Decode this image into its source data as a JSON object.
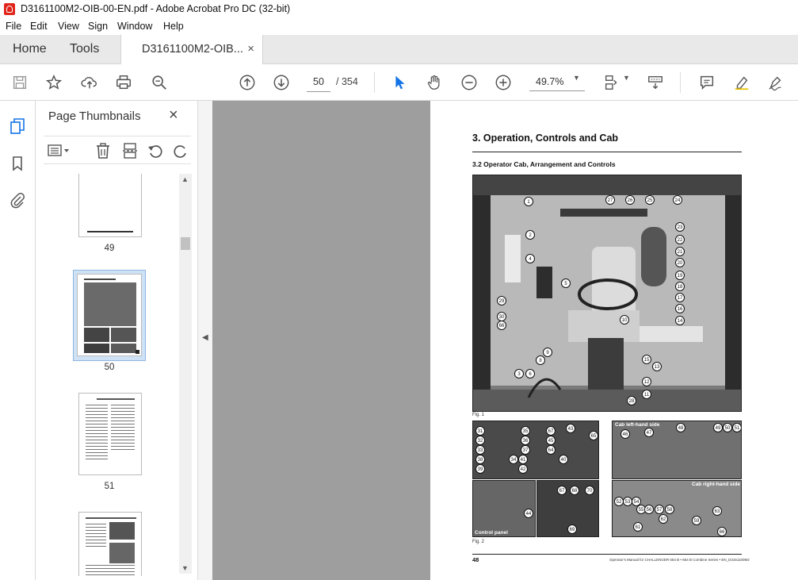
{
  "window": {
    "title": "D3161100M2-OIB-00-EN.pdf - Adobe Acrobat Pro DC (32-bit)"
  },
  "menu": [
    "File",
    "Edit",
    "View",
    "Sign",
    "Window",
    "Help"
  ],
  "tabs": {
    "home": "Home",
    "tools": "Tools",
    "document": "D3161100M2-OIB...",
    "close": "×"
  },
  "toolbar": {
    "page_current": "50",
    "page_total": "/ 354",
    "zoom": "49.7%"
  },
  "thumbnails": {
    "title": "Page Thumbnails",
    "close": "×",
    "pages": [
      {
        "label": "49",
        "selected": false
      },
      {
        "label": "50",
        "selected": true
      },
      {
        "label": "51",
        "selected": false
      },
      {
        "label": "",
        "selected": false
      }
    ]
  },
  "document": {
    "heading": "3. Operation, Controls and Cab",
    "subheading": "3.2     Operator Cab, Arrangement and Controls",
    "fig1_label": "Fig. 1",
    "fig2_label": "Fig. 2",
    "panel_labels": {
      "left_side": "Cab left-hand side",
      "right_side": "Cab right-hand side",
      "control_panel": "Control panel"
    },
    "callouts_main": [
      "1",
      "2",
      "3",
      "4",
      "5",
      "6",
      "7",
      "8",
      "9",
      "10",
      "11",
      "12",
      "13",
      "14",
      "15",
      "16",
      "17",
      "18",
      "19",
      "20",
      "21",
      "22",
      "23",
      "24",
      "25",
      "26",
      "27",
      "28",
      "29",
      "30",
      "66"
    ],
    "callouts_controls": [
      "31",
      "32",
      "33",
      "34",
      "35",
      "36",
      "37",
      "38",
      "39",
      "40",
      "41",
      "42",
      "43",
      "44",
      "45",
      "46",
      "47",
      "48",
      "49",
      "50",
      "51",
      "52",
      "53",
      "54",
      "55",
      "56",
      "57",
      "58",
      "59",
      "60",
      "61",
      "62",
      "63",
      "64",
      "65",
      "66",
      "67",
      "68",
      "69",
      "70"
    ],
    "page_number": "48",
    "footer": "Operator's Manual for CHALLENGER 654 B • 664 B Combine Series • EN_D3161100M2"
  },
  "colors": {
    "accent": "#1473e6",
    "gray_bg": "#9e9e9e",
    "acrobat_red": "#e0251b"
  }
}
